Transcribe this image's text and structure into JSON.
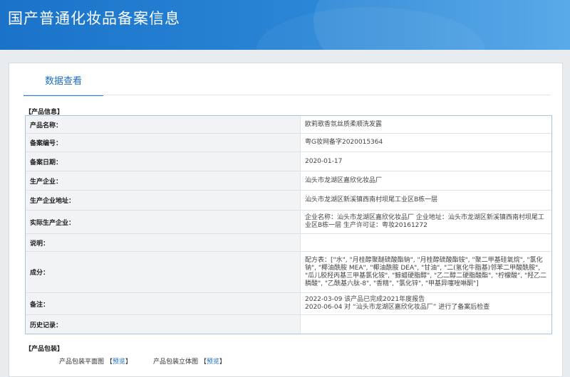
{
  "header": {
    "title": "国产普通化妆品备案信息"
  },
  "tab": {
    "label": "数据查看"
  },
  "product_section": {
    "label": "【产品信息】"
  },
  "rows": [
    {
      "label": "产品名称：",
      "value": "欧莉歌香氛丝质柔顺洗发露"
    },
    {
      "label": "备案编号：",
      "value": "粤G妆网备字2020015364"
    },
    {
      "label": "备案日期：",
      "value": "2020-01-17"
    },
    {
      "label": "生产企业：",
      "value": "汕头市龙湖区嘉欣化妆品厂"
    },
    {
      "label": "生产企业地址：",
      "value": "汕头市龙湖区新溪镇西南村坝尾工业区B栋一层"
    },
    {
      "label": "实际生产企业：",
      "value": "企业名称：汕头市龙湖区嘉欣化妆品厂 企业地址：汕头市龙湖区新溪镇西南村坝尾工业区B栋一层 生产许可证：粤妆20161272"
    },
    {
      "label": "说明：",
      "value": ""
    },
    {
      "label": "成分：",
      "value": "配方表：[\"水\", \"月桂醇聚醚硫酸酯钠\", \"月桂醇硫酸酯铵\", \"聚二甲基硅氧烷\", \"氯化钠\", \"椰油酰胺 MEA\", \"椰油酰胺 DEA\", \"甘油\", \"二(氢化牛脂基)邻苯二甲酸酰胺\", \"瓜儿胶羟丙基三甲基氯化铵\", \"鲸蜡硬脂醇\", \"乙二醇二硬脂酸酯\", \"柠檬酸\", \"羟乙二膦酸\", \"乙酰基六肽-8\", \"香精\", \"氯化锌\", \"甲基异噻唑啉酮\"]"
    },
    {
      "label": "备注：",
      "value_lines": [
        "2022-03-09 该产品已完成2021年度报告",
        "2020-06-04 对 “汕头市龙湖区嘉欣化妆品厂” 进行了备案后检查"
      ]
    },
    {
      "label": "历史记录：",
      "value": ""
    }
  ],
  "package_section": {
    "label": "【产品包装】"
  },
  "package": {
    "flat_label": "产品包装平面图",
    "flat_link": "预览",
    "solid_label": "产品包装立体图",
    "solid_link": "预览",
    "bracket_open": "【",
    "bracket_close": "】"
  }
}
